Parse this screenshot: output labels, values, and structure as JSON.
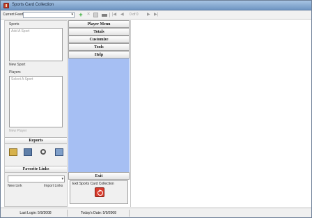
{
  "window": {
    "title": "Sports Card Collection"
  },
  "toolbar": {
    "feed_label": "Current Feeds:",
    "feed_value": "",
    "nav_position": "0 of 0"
  },
  "left_panel": {
    "sports_label": "Sports",
    "sports_placeholder": "Add A Sport",
    "new_sport": "New Sport",
    "players_label": "Players",
    "players_placeholder": "Select A Sport",
    "new_player": "New Player",
    "reports_title": "Reports",
    "favorite_links_title": "Favorite Links",
    "favorite_links_value": "",
    "new_link": "New Link",
    "import_links": "Import Links"
  },
  "menu": {
    "items": [
      "Player Menu",
      "Totals",
      "Customize",
      "Tools",
      "Help"
    ],
    "exit_label": "Exit",
    "exit_caption": "Exit Sports Card Collection"
  },
  "status": {
    "last_login": "Last Login: 5/9/2008",
    "todays_date": "Today's Date: 5/9/2008"
  },
  "colors": {
    "menu_fill": "#a6bff3",
    "titlebar": "#8fb0d8",
    "exit_icon": "#d93b2c"
  }
}
